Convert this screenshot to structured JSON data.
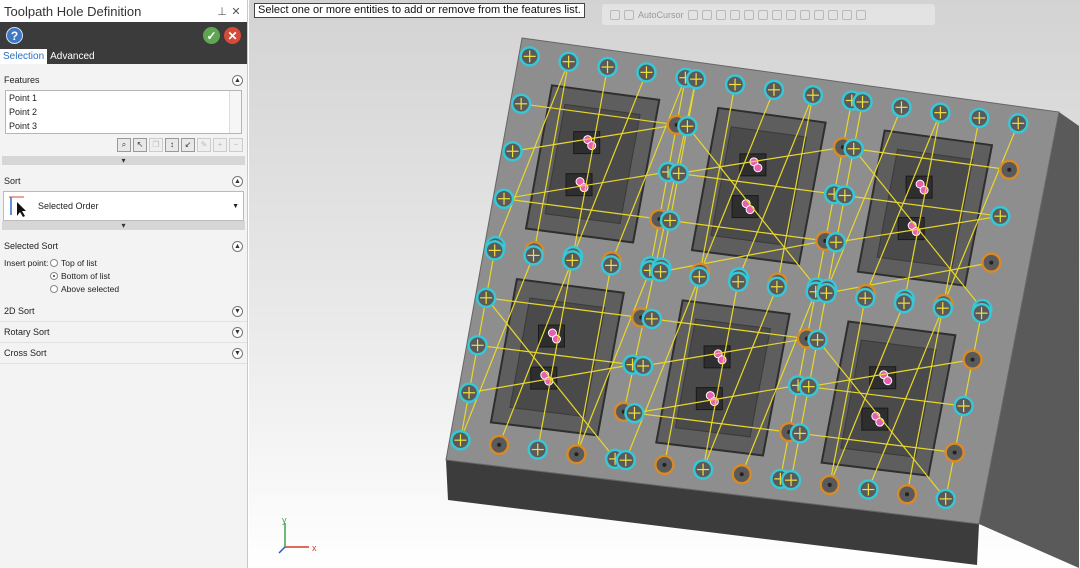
{
  "panel": {
    "title": "Toolpath Hole Definition",
    "pin_icon": "pin-icon",
    "close_icon": "close-icon",
    "help_icon": "help-icon",
    "ok_icon": "check-icon",
    "cancel_icon": "cancel-icon",
    "tabs": [
      {
        "label": "Selection",
        "active": true
      },
      {
        "label": "Advanced",
        "active": false
      }
    ],
    "features": {
      "heading": "Features",
      "items": [
        "Point 1",
        "Point 2",
        "Point 3"
      ],
      "toolbar_icons": [
        "zoom-select-icon",
        "select-cursor-icon",
        "copy-icon",
        "reverse-icon",
        "import-icon",
        "edit-icon",
        "add-icon",
        "remove-icon"
      ]
    },
    "sort": {
      "heading": "Sort",
      "selected": "Selected Order"
    },
    "selected_sort": {
      "heading": "Selected Sort",
      "insert_label": "Insert point:",
      "options": [
        {
          "label": "Top of list",
          "checked": false
        },
        {
          "label": "Bottom of list",
          "checked": true
        },
        {
          "label": "Above selected",
          "checked": false
        }
      ]
    },
    "collapsed_sections": [
      "2D Sort",
      "Rotary Sort",
      "Cross Sort"
    ]
  },
  "viewport": {
    "tooltip": "Select one or more entities to add or remove from the features list.",
    "toolbar": {
      "autocursor_label": "AutoCursor"
    },
    "colors": {
      "plate_top": "#8e8e8e",
      "plate_side": "#4a4a4a",
      "selected_hole_ring": "#38c7d6",
      "unselected_hole_ring": "#d68a2a",
      "toolpath_line": "#e8d82a",
      "hole_marker": "#f0e040"
    },
    "triad": {
      "x_label": "x",
      "y_label": "y"
    }
  }
}
